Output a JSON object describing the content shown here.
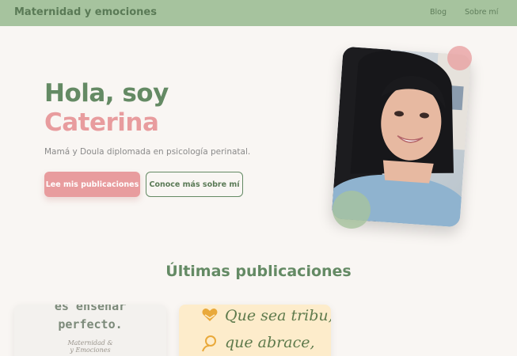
{
  "nav": {
    "brand": "Maternidad y emociones",
    "links": [
      "Blog",
      "Sobre mí"
    ]
  },
  "hero": {
    "title_line1": "Hola, soy",
    "title_line2": "Caterina",
    "subtitle": "Mamá y Doula diplomada en psicología perinatal.",
    "btn_primary": "Lee mis publicaciones",
    "btn_secondary": "Conoce más sobre mí"
  },
  "section": {
    "title": "Últimas publicaciones"
  },
  "posts": [
    {
      "line1": "es enseñar",
      "line2": "perfecto.",
      "line3": "Maternidad &\ny Emociones"
    },
    {
      "line1": "Que sea tribu,",
      "line2": "que abrace,"
    }
  ],
  "colors": {
    "nav_bg": "#a6c39e",
    "green": "#648a64",
    "pink": "#e89c9e",
    "page_bg": "#f9f6f3"
  },
  "icons": [
    "heart-hands-icon",
    "person-icon"
  ]
}
